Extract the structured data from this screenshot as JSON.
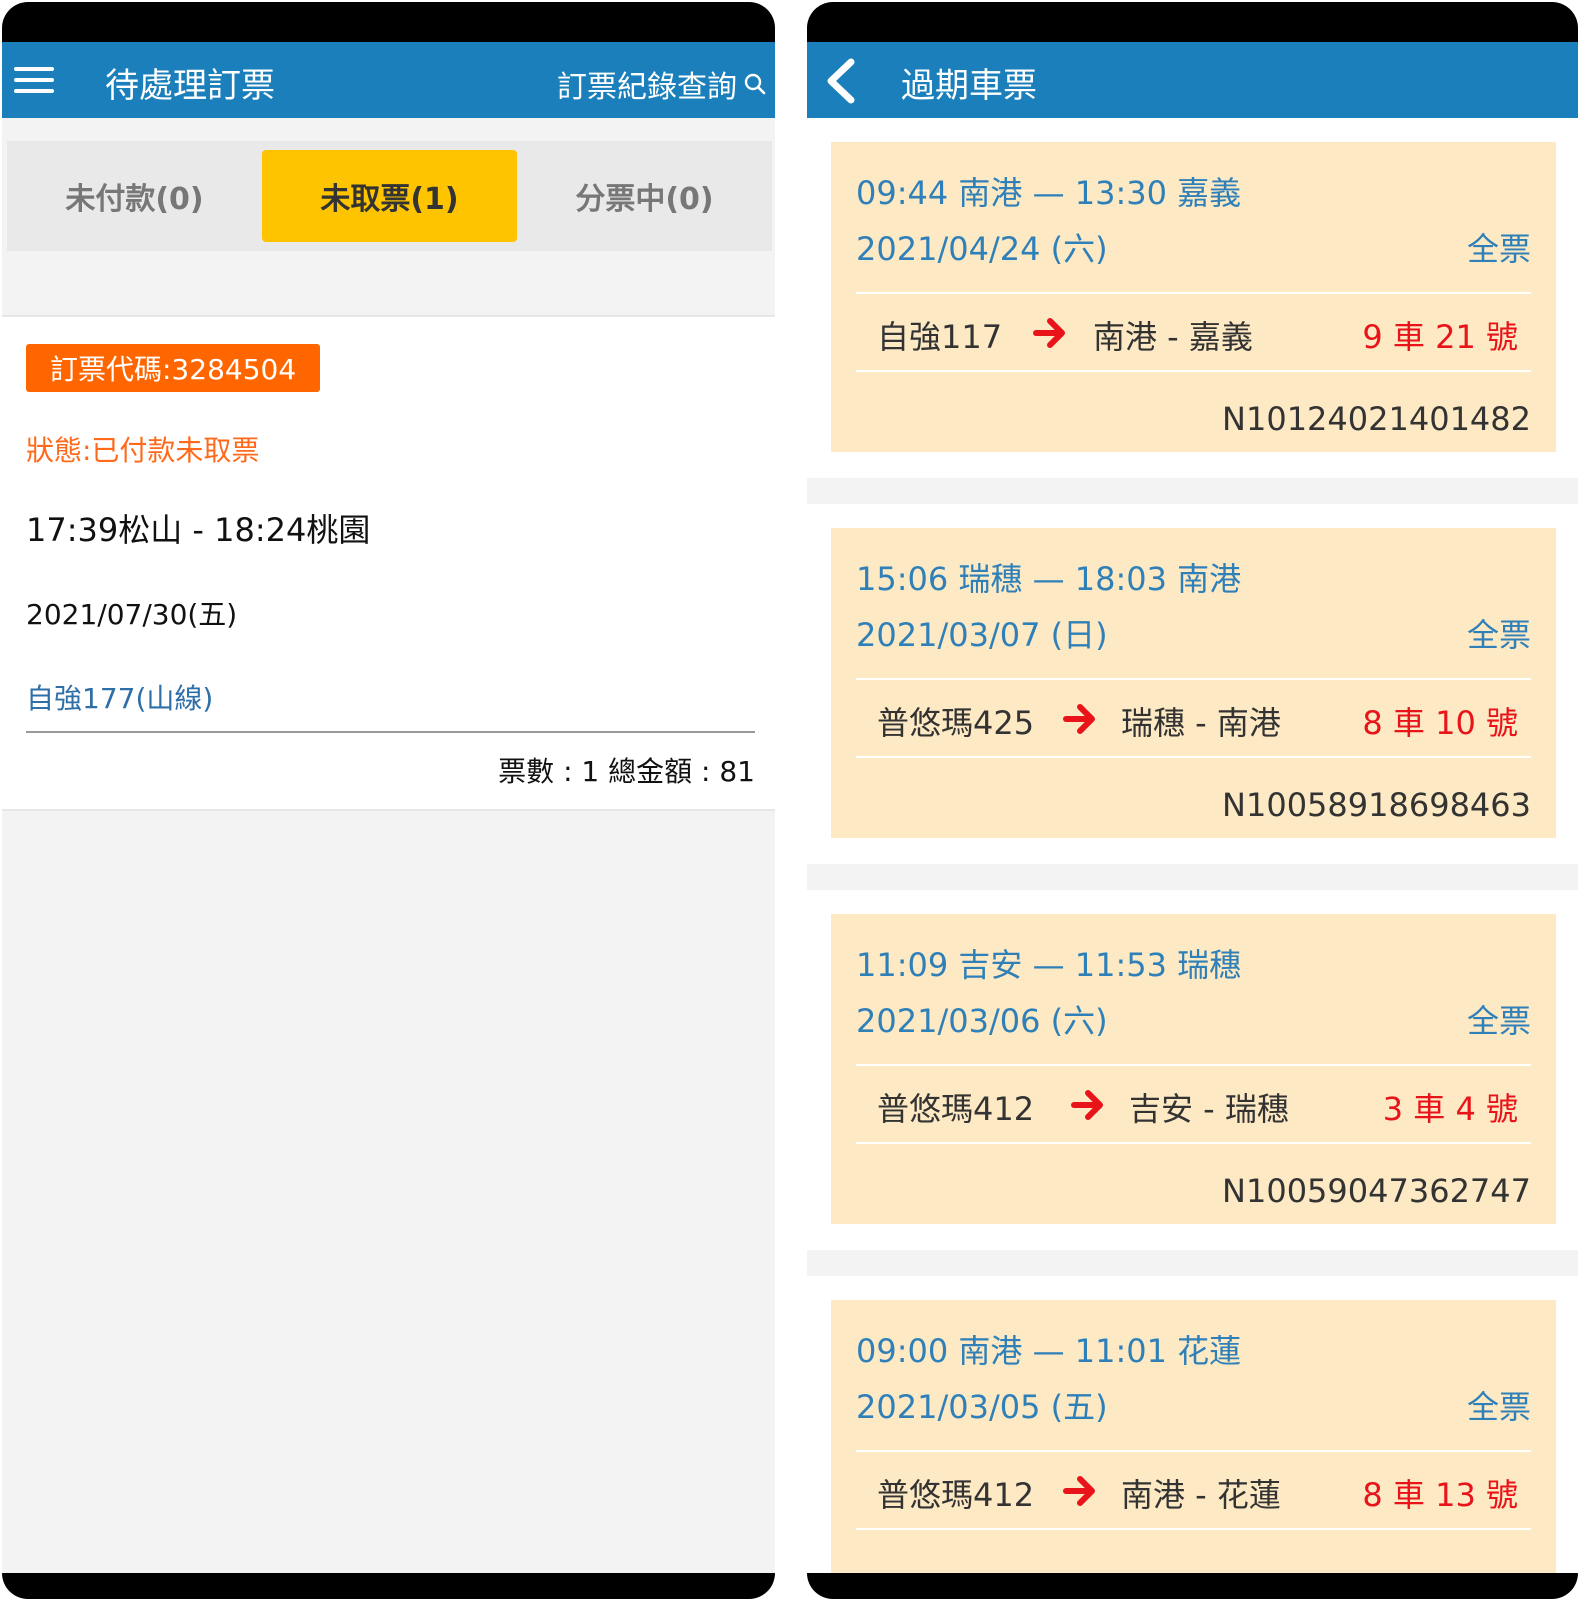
{
  "left": {
    "title": "待處理訂票",
    "search_label": "訂票紀錄查詢",
    "tabs": [
      {
        "label": "未付款(0)",
        "active": false
      },
      {
        "label": "未取票(1)",
        "active": true
      },
      {
        "label": "分票中(0)",
        "active": false
      }
    ],
    "order": {
      "code": "訂票代碼:3284504",
      "status": "狀態:已付款未取票",
      "route": "17:39松山 - 18:24桃園",
      "date": "2021/07/30(五)",
      "train": "自強177(山線)",
      "summary": "票數 : 1 總金額 : 81"
    }
  },
  "right": {
    "title": "過期車票",
    "tickets": [
      {
        "route": "09:44 南港 — 13:30 嘉義",
        "date": "2021/04/24 (六)",
        "type": "全票",
        "train": "自強117",
        "stations": "南港 - 嘉義",
        "seat": "9 車 21 號",
        "number": "N10124021401482"
      },
      {
        "route": "15:06 瑞穗 — 18:03 南港",
        "date": "2021/03/07 (日)",
        "type": "全票",
        "train": "普悠瑪425",
        "stations": "瑞穗 - 南港",
        "seat": "8 車 10 號",
        "number": "N10058918698463"
      },
      {
        "route": "11:09 吉安 — 11:53 瑞穗",
        "date": "2021/03/06 (六)",
        "type": "全票",
        "train": "普悠瑪412",
        "stations": "吉安 - 瑞穗",
        "seat": "3 車 4 號",
        "number": "N10059047362747"
      },
      {
        "route": "09:00 南港 — 11:01 花蓮",
        "date": "2021/03/05 (五)",
        "type": "全票",
        "train": "普悠瑪412",
        "stations": "南港 - 花蓮",
        "seat": "8 車 13 號",
        "number": ""
      }
    ]
  },
  "colors": {
    "header_blue": "#1a7fba",
    "tab_active": "#ffc400",
    "order_code_bg": "#ff6600",
    "ticket_bg": "#fde9c4",
    "seat_red": "#e8141a"
  },
  "icons": [
    "menu-icon",
    "search-icon",
    "back-chevron-icon",
    "arrow-right-icon"
  ]
}
